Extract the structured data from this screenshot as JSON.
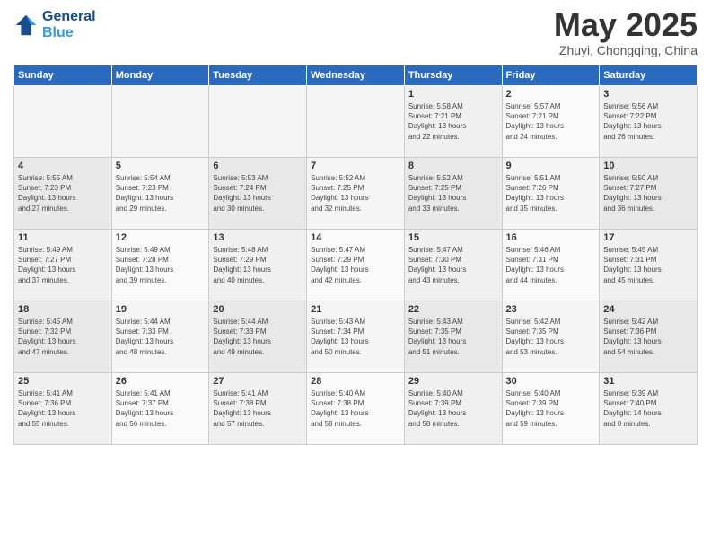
{
  "header": {
    "logo_line1": "General",
    "logo_line2": "Blue",
    "month": "May 2025",
    "location": "Zhuyi, Chongqing, China"
  },
  "weekdays": [
    "Sunday",
    "Monday",
    "Tuesday",
    "Wednesday",
    "Thursday",
    "Friday",
    "Saturday"
  ],
  "weeks": [
    [
      {
        "day": "",
        "info": ""
      },
      {
        "day": "",
        "info": ""
      },
      {
        "day": "",
        "info": ""
      },
      {
        "day": "",
        "info": ""
      },
      {
        "day": "1",
        "info": "Sunrise: 5:58 AM\nSunset: 7:21 PM\nDaylight: 13 hours\nand 22 minutes."
      },
      {
        "day": "2",
        "info": "Sunrise: 5:57 AM\nSunset: 7:21 PM\nDaylight: 13 hours\nand 24 minutes."
      },
      {
        "day": "3",
        "info": "Sunrise: 5:56 AM\nSunset: 7:22 PM\nDaylight: 13 hours\nand 26 minutes."
      }
    ],
    [
      {
        "day": "4",
        "info": "Sunrise: 5:55 AM\nSunset: 7:23 PM\nDaylight: 13 hours\nand 27 minutes."
      },
      {
        "day": "5",
        "info": "Sunrise: 5:54 AM\nSunset: 7:23 PM\nDaylight: 13 hours\nand 29 minutes."
      },
      {
        "day": "6",
        "info": "Sunrise: 5:53 AM\nSunset: 7:24 PM\nDaylight: 13 hours\nand 30 minutes."
      },
      {
        "day": "7",
        "info": "Sunrise: 5:52 AM\nSunset: 7:25 PM\nDaylight: 13 hours\nand 32 minutes."
      },
      {
        "day": "8",
        "info": "Sunrise: 5:52 AM\nSunset: 7:25 PM\nDaylight: 13 hours\nand 33 minutes."
      },
      {
        "day": "9",
        "info": "Sunrise: 5:51 AM\nSunset: 7:26 PM\nDaylight: 13 hours\nand 35 minutes."
      },
      {
        "day": "10",
        "info": "Sunrise: 5:50 AM\nSunset: 7:27 PM\nDaylight: 13 hours\nand 36 minutes."
      }
    ],
    [
      {
        "day": "11",
        "info": "Sunrise: 5:49 AM\nSunset: 7:27 PM\nDaylight: 13 hours\nand 37 minutes."
      },
      {
        "day": "12",
        "info": "Sunrise: 5:49 AM\nSunset: 7:28 PM\nDaylight: 13 hours\nand 39 minutes."
      },
      {
        "day": "13",
        "info": "Sunrise: 5:48 AM\nSunset: 7:29 PM\nDaylight: 13 hours\nand 40 minutes."
      },
      {
        "day": "14",
        "info": "Sunrise: 5:47 AM\nSunset: 7:29 PM\nDaylight: 13 hours\nand 42 minutes."
      },
      {
        "day": "15",
        "info": "Sunrise: 5:47 AM\nSunset: 7:30 PM\nDaylight: 13 hours\nand 43 minutes."
      },
      {
        "day": "16",
        "info": "Sunrise: 5:46 AM\nSunset: 7:31 PM\nDaylight: 13 hours\nand 44 minutes."
      },
      {
        "day": "17",
        "info": "Sunrise: 5:45 AM\nSunset: 7:31 PM\nDaylight: 13 hours\nand 45 minutes."
      }
    ],
    [
      {
        "day": "18",
        "info": "Sunrise: 5:45 AM\nSunset: 7:32 PM\nDaylight: 13 hours\nand 47 minutes."
      },
      {
        "day": "19",
        "info": "Sunrise: 5:44 AM\nSunset: 7:33 PM\nDaylight: 13 hours\nand 48 minutes."
      },
      {
        "day": "20",
        "info": "Sunrise: 5:44 AM\nSunset: 7:33 PM\nDaylight: 13 hours\nand 49 minutes."
      },
      {
        "day": "21",
        "info": "Sunrise: 5:43 AM\nSunset: 7:34 PM\nDaylight: 13 hours\nand 50 minutes."
      },
      {
        "day": "22",
        "info": "Sunrise: 5:43 AM\nSunset: 7:35 PM\nDaylight: 13 hours\nand 51 minutes."
      },
      {
        "day": "23",
        "info": "Sunrise: 5:42 AM\nSunset: 7:35 PM\nDaylight: 13 hours\nand 53 minutes."
      },
      {
        "day": "24",
        "info": "Sunrise: 5:42 AM\nSunset: 7:36 PM\nDaylight: 13 hours\nand 54 minutes."
      }
    ],
    [
      {
        "day": "25",
        "info": "Sunrise: 5:41 AM\nSunset: 7:36 PM\nDaylight: 13 hours\nand 55 minutes."
      },
      {
        "day": "26",
        "info": "Sunrise: 5:41 AM\nSunset: 7:37 PM\nDaylight: 13 hours\nand 56 minutes."
      },
      {
        "day": "27",
        "info": "Sunrise: 5:41 AM\nSunset: 7:38 PM\nDaylight: 13 hours\nand 57 minutes."
      },
      {
        "day": "28",
        "info": "Sunrise: 5:40 AM\nSunset: 7:38 PM\nDaylight: 13 hours\nand 58 minutes."
      },
      {
        "day": "29",
        "info": "Sunrise: 5:40 AM\nSunset: 7:39 PM\nDaylight: 13 hours\nand 58 minutes."
      },
      {
        "day": "30",
        "info": "Sunrise: 5:40 AM\nSunset: 7:39 PM\nDaylight: 13 hours\nand 59 minutes."
      },
      {
        "day": "31",
        "info": "Sunrise: 5:39 AM\nSunset: 7:40 PM\nDaylight: 14 hours\nand 0 minutes."
      }
    ]
  ]
}
